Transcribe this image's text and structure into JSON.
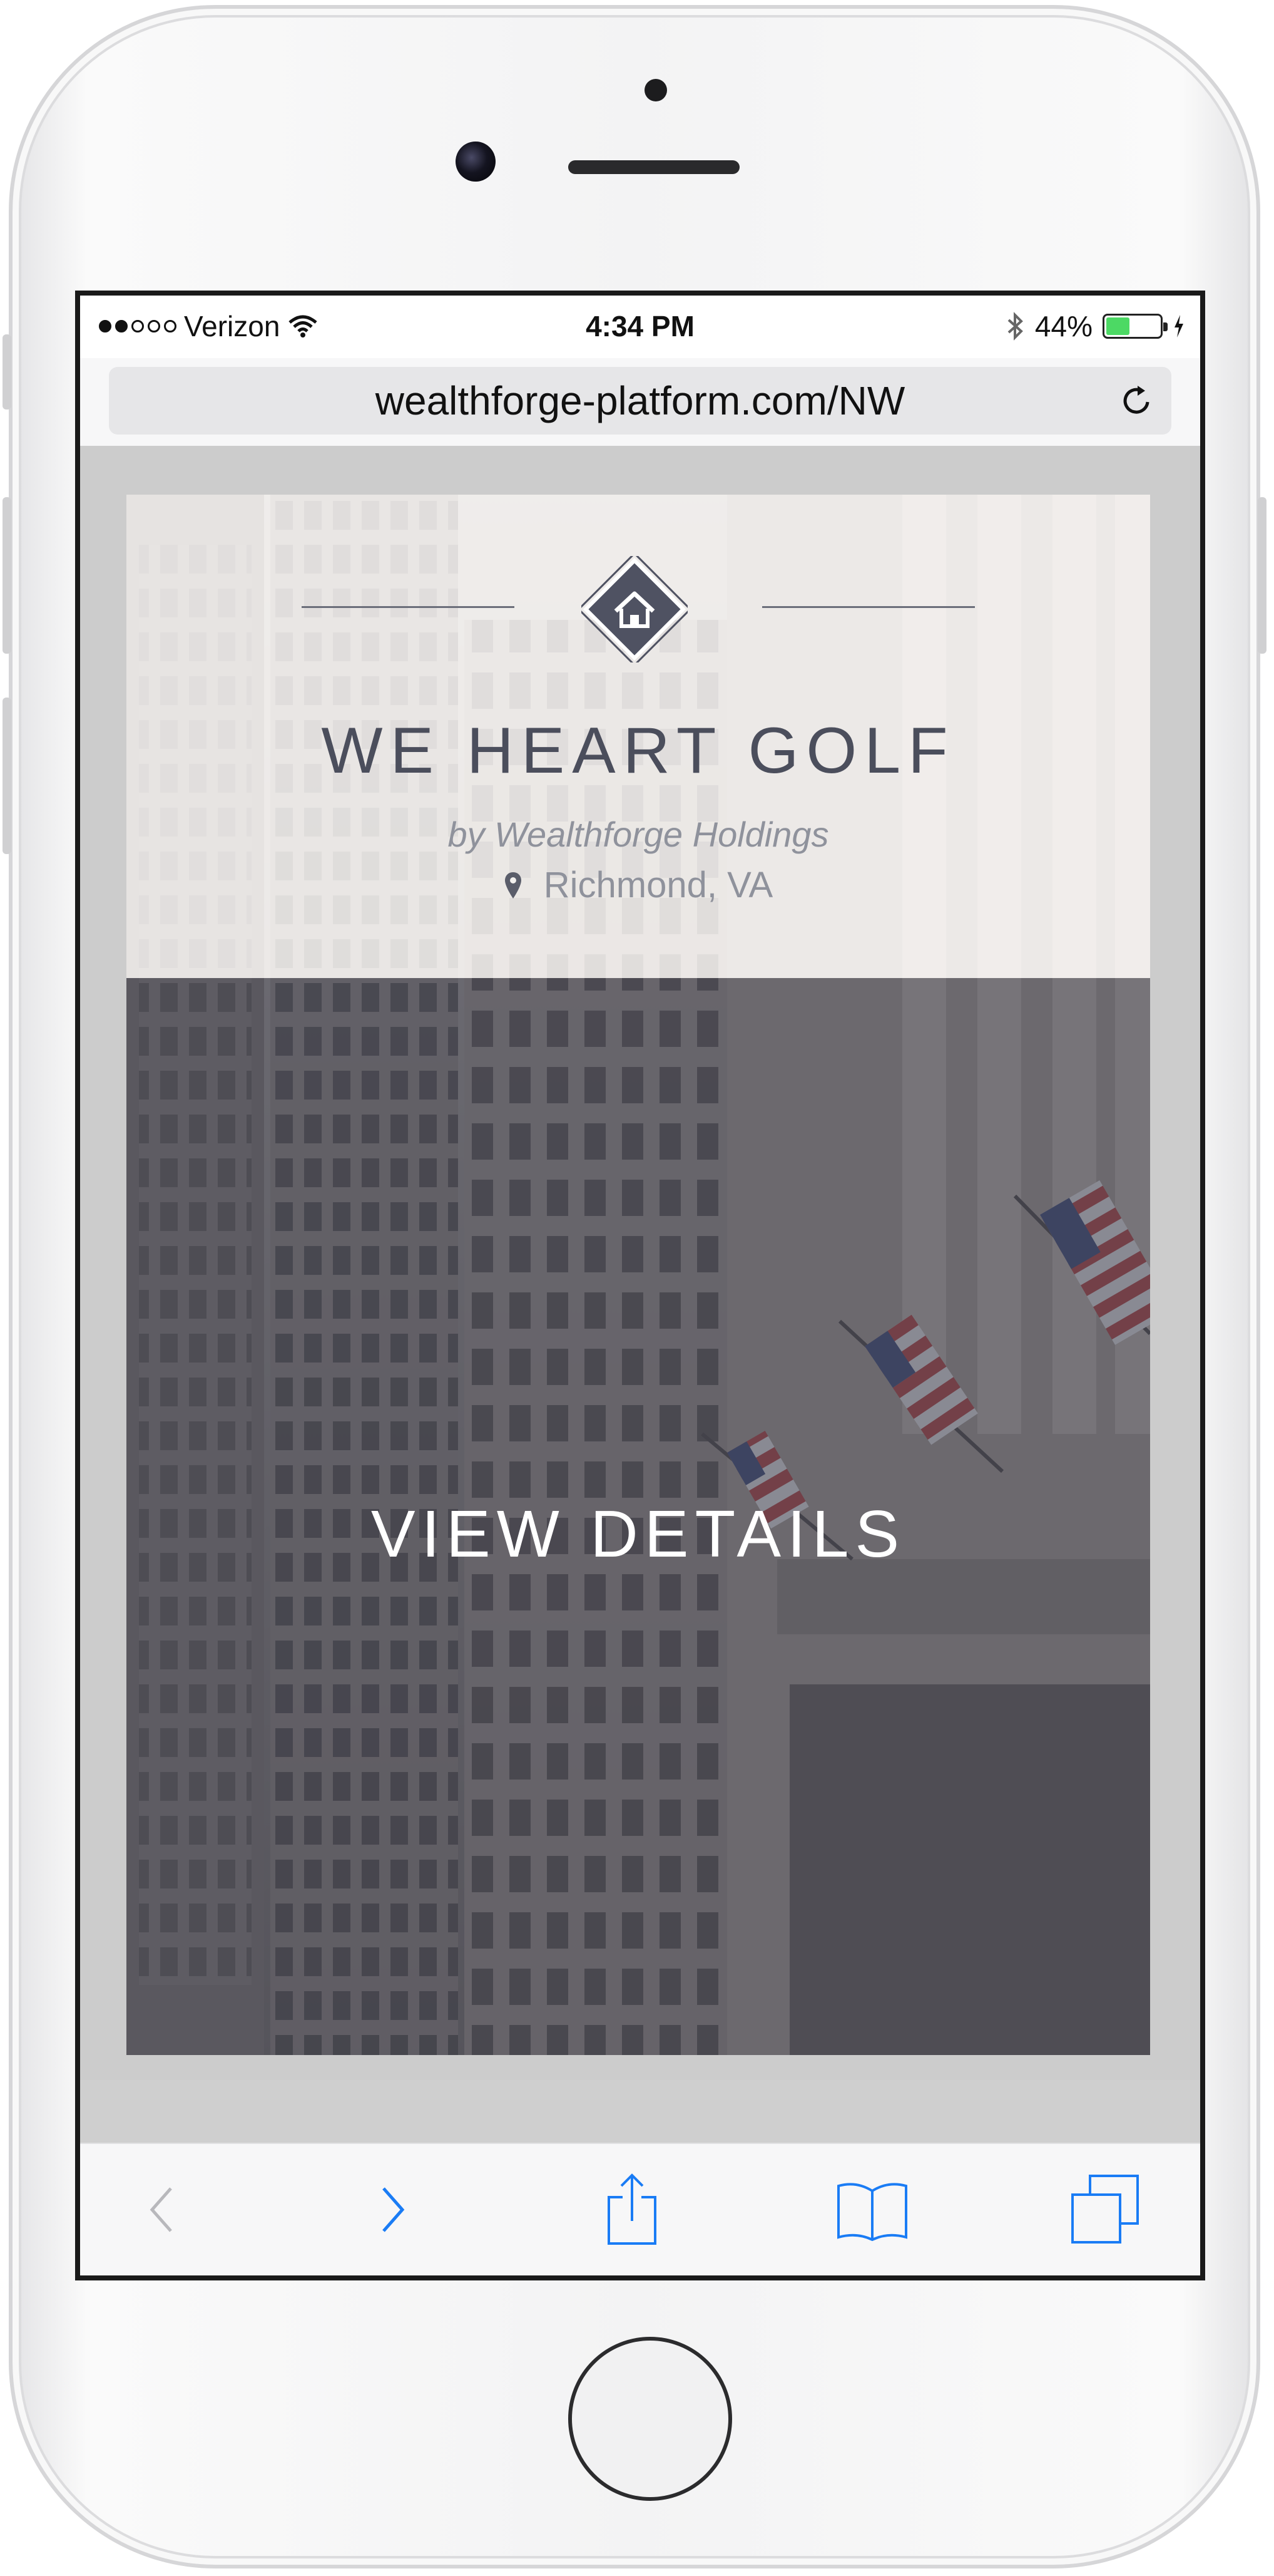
{
  "status_bar": {
    "carrier": "Verizon",
    "time": "4:34 PM",
    "battery_percent": "44%",
    "battery_level": 0.44,
    "signal_bars_filled": 2,
    "signal_bars_total": 5
  },
  "browser": {
    "url": "wealthforge-platform.com/NW"
  },
  "offering": {
    "title": "WE HEART GOLF",
    "byline": "by Wealthforge Holdings",
    "location": "Richmond, VA",
    "cta": "VIEW DETAILS"
  },
  "toolbar": {
    "back_enabled": false,
    "forward_enabled": true
  },
  "colors": {
    "accent_blue": "#1a7cf5",
    "brand_slate": "#4b4e5c",
    "battery_green": "#4cd964"
  },
  "icons": [
    "wifi-icon",
    "bluetooth-icon",
    "battery-icon",
    "reload-icon",
    "home-icon",
    "location-pin-icon",
    "back-icon",
    "forward-icon",
    "share-icon",
    "bookmarks-icon",
    "tabs-icon"
  ]
}
